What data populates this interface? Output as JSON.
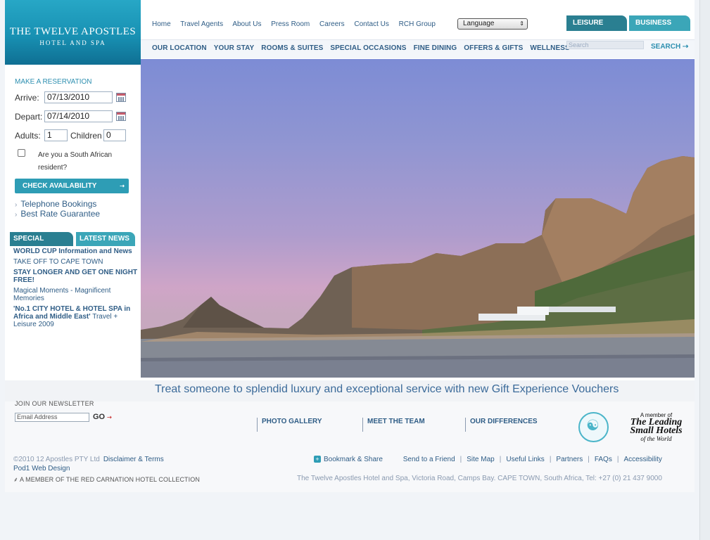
{
  "logo": {
    "line1": "THE TWELVE APOSTLES",
    "line2": "HOTEL AND SPA"
  },
  "top_links": [
    "Home",
    "Travel Agents",
    "About Us",
    "Press Room",
    "Careers",
    "Contact Us",
    "RCH Group"
  ],
  "language": {
    "label": "Language",
    "arrow": "⇕"
  },
  "tabs": {
    "leisure": "LEISURE",
    "business": "BUSINESS"
  },
  "main_nav": [
    "OUR LOCATION",
    "YOUR STAY",
    "ROOMS & SUITES",
    "SPECIAL OCCASIONS",
    "FINE DINING",
    "OFFERS & GIFTS",
    "WELLNESS"
  ],
  "search": {
    "placeholder": "Search",
    "button": "SEARCH ⇢"
  },
  "reservation": {
    "title": "MAKE A RESERVATION",
    "arrive_label": "Arrive:",
    "arrive_value": "07/13/2010",
    "depart_label": "Depart:",
    "depart_value": "07/14/2010",
    "adults_label": "Adults:",
    "adults_value": "1",
    "children_label": "Children",
    "children_value": "0",
    "resident_question": "Are you a South African resident?",
    "check_button": "CHECK AVAILABILITY",
    "check_arrow": "⇢",
    "links": [
      "Telephone Bookings",
      "Best Rate Guarantee"
    ]
  },
  "news_tabs": {
    "special_offers": "SPECIAL OFFERS",
    "latest_news": "LATEST NEWS"
  },
  "news": {
    "n1_bold": "WORLD CUP",
    "n1_rest": " Information and News",
    "n2": "TAKE OFF TO CAPE TOWN",
    "n3": "STAY LONGER AND GET ONE NIGHT FREE!",
    "n4": "Magical Moments - Magnificent Memories",
    "n5_bold": "'No.1 CITY HOTEL & HOTEL SPA in Africa and Middle East'",
    "n5_rest": " Travel + Leisure 2009"
  },
  "banner": "Treat someone to splendid luxury and exceptional service with new Gift Experience Vouchers",
  "newsletter": {
    "title": "JOIN OUR NEWSLETTER",
    "placeholder": "Email Address",
    "go": "GO",
    "go_arrow": "⇢"
  },
  "footer_links": [
    "PHOTO GALLERY",
    "MEET THE TEAM",
    "OUR DIFFERENCES"
  ],
  "lsh": {
    "a": "A member of",
    "b": "The Leading Small Hotels",
    "c": "of the World"
  },
  "copyright": "©2010 12 Apostles PTY Ltd",
  "disclaimer": "Disclaimer & Terms",
  "pod": "Pod1 Web Design",
  "rch": "A MEMBER OF THE RED CARNATION HOTEL COLLECTION",
  "bottom_links": {
    "bookmark": "Bookmark & Share",
    "friend": "Send to a Friend",
    "sitemap": "Site Map",
    "useful": "Useful Links",
    "partners": "Partners",
    "faqs": "FAQs",
    "access": "Accessibility"
  },
  "address": "The Twelve Apostles Hotel and Spa, Victoria Road, Camps Bay. CAPE TOWN, South Africa, Tel: +27 (0) 21 437 9000",
  "colors": {
    "teal": "#2e9db5",
    "dark_teal": "#2a7f91",
    "link_blue": "#2f5d86"
  }
}
